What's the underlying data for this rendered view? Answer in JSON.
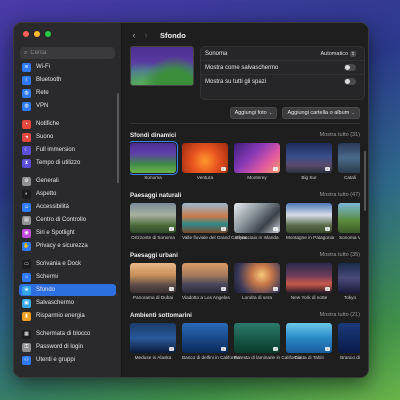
{
  "sidebar": {
    "search_placeholder": "Cerca",
    "traffic_colors": [
      "#ff5f57",
      "#febc2e",
      "#28c840"
    ],
    "groups": [
      [
        {
          "label": "Wi-Fi",
          "icon": "wifi-icon",
          "color": "#2f7bf5",
          "glyph": "≋"
        },
        {
          "label": "Bluetooth",
          "icon": "bluetooth-icon",
          "color": "#2f7bf5",
          "glyph": "ᛒ"
        },
        {
          "label": "Rete",
          "icon": "network-icon",
          "color": "#2f7bf5",
          "glyph": "◍"
        },
        {
          "label": "VPN",
          "icon": "vpn-icon",
          "color": "#2f7bf5",
          "glyph": "◍"
        }
      ],
      [
        {
          "label": "Notifiche",
          "icon": "notifications-icon",
          "color": "#e5483e",
          "glyph": "▪"
        },
        {
          "label": "Suono",
          "icon": "sound-icon",
          "color": "#e5483e",
          "glyph": "◂"
        },
        {
          "label": "Full immersion",
          "icon": "focus-icon",
          "color": "#5a4fd6",
          "glyph": "☾"
        },
        {
          "label": "Tempo di utilizzo",
          "icon": "screen-time-icon",
          "color": "#5a4fd6",
          "glyph": "⧗"
        }
      ],
      [
        {
          "label": "Generali",
          "icon": "gear-icon",
          "color": "#8e8e93",
          "glyph": "⚙"
        },
        {
          "label": "Aspetto",
          "icon": "appearance-icon",
          "color": "#1c1c1e",
          "glyph": "◐"
        },
        {
          "label": "Accessibilità",
          "icon": "accessibility-icon",
          "color": "#2f7bf5",
          "glyph": "☺"
        },
        {
          "label": "Centro di Controllo",
          "icon": "control-center-icon",
          "color": "#8e8e93",
          "glyph": "▤"
        },
        {
          "label": "Siri e Spotlight",
          "icon": "siri-icon",
          "color": "#c04bd8",
          "glyph": "◉"
        },
        {
          "label": "Privacy e sicurezza",
          "icon": "privacy-icon",
          "color": "#2f7bf5",
          "glyph": "✋"
        }
      ],
      [
        {
          "label": "Scrivania e Dock",
          "icon": "desktop-dock-icon",
          "color": "#1c1c1e",
          "glyph": "▭"
        },
        {
          "label": "Schermi",
          "icon": "displays-icon",
          "color": "#2f7bf5",
          "glyph": "☼"
        },
        {
          "label": "Sfondo",
          "icon": "wallpaper-icon",
          "color": "#35a8e8",
          "glyph": "❀",
          "active": true
        },
        {
          "label": "Salvaschermo",
          "icon": "screensaver-icon",
          "color": "#35a8e8",
          "glyph": "▣"
        },
        {
          "label": "Risparmio energia",
          "icon": "energy-icon",
          "color": "#f0a020",
          "glyph": "▮"
        }
      ],
      [
        {
          "label": "Schermata di blocco",
          "icon": "lock-screen-icon",
          "color": "#1c1c1e",
          "glyph": "▦"
        },
        {
          "label": "Password di login",
          "icon": "password-icon",
          "color": "#8e8e93",
          "glyph": "⚿"
        },
        {
          "label": "Utenti e gruppi",
          "icon": "users-icon",
          "color": "#2f7bf5",
          "glyph": "⚇"
        }
      ]
    ]
  },
  "toolbar": {
    "back": "‹",
    "forward": "›",
    "title": "Sfondo"
  },
  "current": {
    "name": "Sonoma",
    "fit_value": "Automatico",
    "screensaver_label": "Mostra come salvaschermo",
    "all_spaces_label": "Mostra su tutti gli spazi",
    "add_photo": "Aggiungi foto",
    "add_folder": "Aggiungi cartella o album"
  },
  "sections": [
    {
      "title": "Sfondi dinamici",
      "show_all": "Mostra tutto (31)",
      "tiles": [
        {
          "caption": "Sonoma",
          "bg": "linear-gradient(180deg,#4b2e92 0%,#5f3fa8 35%,#3f8a4a 70%,#6ab34a 100%)",
          "sel": true
        },
        {
          "caption": "Ventura",
          "bg": "radial-gradient(circle at 50% 60%,#ff9a2e 0%,#e8531f 45%,#9a2a12 100%)",
          "dl": true
        },
        {
          "caption": "Monterey",
          "bg": "linear-gradient(135deg,#3a1f7a 0%,#8a3ab8 40%,#e05aa0 70%,#f29a6a 100%)",
          "dl": true
        },
        {
          "caption": "Big Sur",
          "bg": "linear-gradient(180deg,#1e2a5a 0%,#3a4f8a 45%,#5a4a6a 75%,#2a3040 100%)",
          "dl": true
        },
        {
          "caption": "Catali",
          "bg": "linear-gradient(180deg,#2a3a5a 0%,#4a6a8a 50%,#2a3a4a 100%)",
          "cut": true
        }
      ]
    },
    {
      "title": "Paesaggi naturali",
      "show_all": "Mostra tutto (47)",
      "tiles": [
        {
          "caption": "Orizzonte di Sonoma",
          "bg": "linear-gradient(180deg,#7a8a9a 0%,#a8b0a0 40%,#4a6a3a 75%,#2f4a2a 100%)",
          "dl": true
        },
        {
          "caption": "Valle fluviale del Grand Canyon",
          "bg": "linear-gradient(180deg,#9ab8d0 0%,#c87a4a 45%,#2f8a8a 70%,#7a4a2a 100%)",
          "dl": true
        },
        {
          "caption": "Ghiacciaio in Islanda",
          "bg": "linear-gradient(135deg,#e8ecf0 0%,#8a949a 40%,#3a4048 70%,#d0d6da 100%)",
          "dl": true
        },
        {
          "caption": "Montagne in Patagonia",
          "bg": "linear-gradient(180deg,#4a78b8 0%,#d8dce8 40%,#5a6a4a 75%,#3a4a2a 100%)",
          "dl": true
        },
        {
          "caption": "Sonoma V",
          "bg": "linear-gradient(180deg,#7ab8d8 0%,#5a8a3a 60%,#3a5a2a 100%)",
          "cut": true
        }
      ]
    },
    {
      "title": "Paesaggi urbani",
      "show_all": "Mostra tutto (35)",
      "tiles": [
        {
          "caption": "Panorama di Dubai",
          "bg": "linear-gradient(180deg,#e8b888 0%,#c8905a 40%,#5a4a4a 75%,#3a3030 100%)",
          "dl": true
        },
        {
          "caption": "Viadotto a Los Angeles",
          "bg": "linear-gradient(180deg,#d89a6a 0%,#a87a5a 40%,#4a4a5a 70%,#2a2a3a 100%)",
          "dl": true
        },
        {
          "caption": "Londra di sera",
          "bg": "radial-gradient(circle at 60% 40%,#f8c87a 0%,#c8784a 30%,#3a3a5a 70%,#1a1a2a 100%)",
          "dl": true
        },
        {
          "caption": "New York di notte",
          "bg": "linear-gradient(180deg,#2a2a4a 0%,#6a3a5a 40%,#c85a4a 70%,#2a1a2a 100%)",
          "dl": true
        },
        {
          "caption": "Tokyo",
          "bg": "linear-gradient(180deg,#1a2a4a 0%,#4a4a7a 50%,#1a1a3a 100%)",
          "cut": true
        }
      ]
    },
    {
      "title": "Ambienti sottomarini",
      "show_all": "Mostra tutto (21)",
      "tiles": [
        {
          "caption": "Meduse in Alaska",
          "bg": "linear-gradient(180deg,#1a3a6a 0%,#2a5a9a 50%,#0a1a3a 100%)",
          "dl": true
        },
        {
          "caption": "Banco di delfini in California",
          "bg": "linear-gradient(180deg,#2a6ab8 0%,#1a4a8a 50%,#0a2a5a 100%)",
          "dl": true
        },
        {
          "caption": "Foresta di laminarie in California",
          "bg": "linear-gradient(180deg,#2a7a6a 0%,#1a5a4a 50%,#0a3a2a 100%)",
          "dl": true
        },
        {
          "caption": "Costa di Tahiti",
          "bg": "linear-gradient(180deg,#6ac8e8 0%,#2a8ac8 50%,#1a5a9a 100%)",
          "dl": true
        },
        {
          "caption": "Branco di",
          "bg": "linear-gradient(180deg,#1a3a7a 0%,#0a1a4a 100%)",
          "cut": true
        }
      ]
    }
  ]
}
